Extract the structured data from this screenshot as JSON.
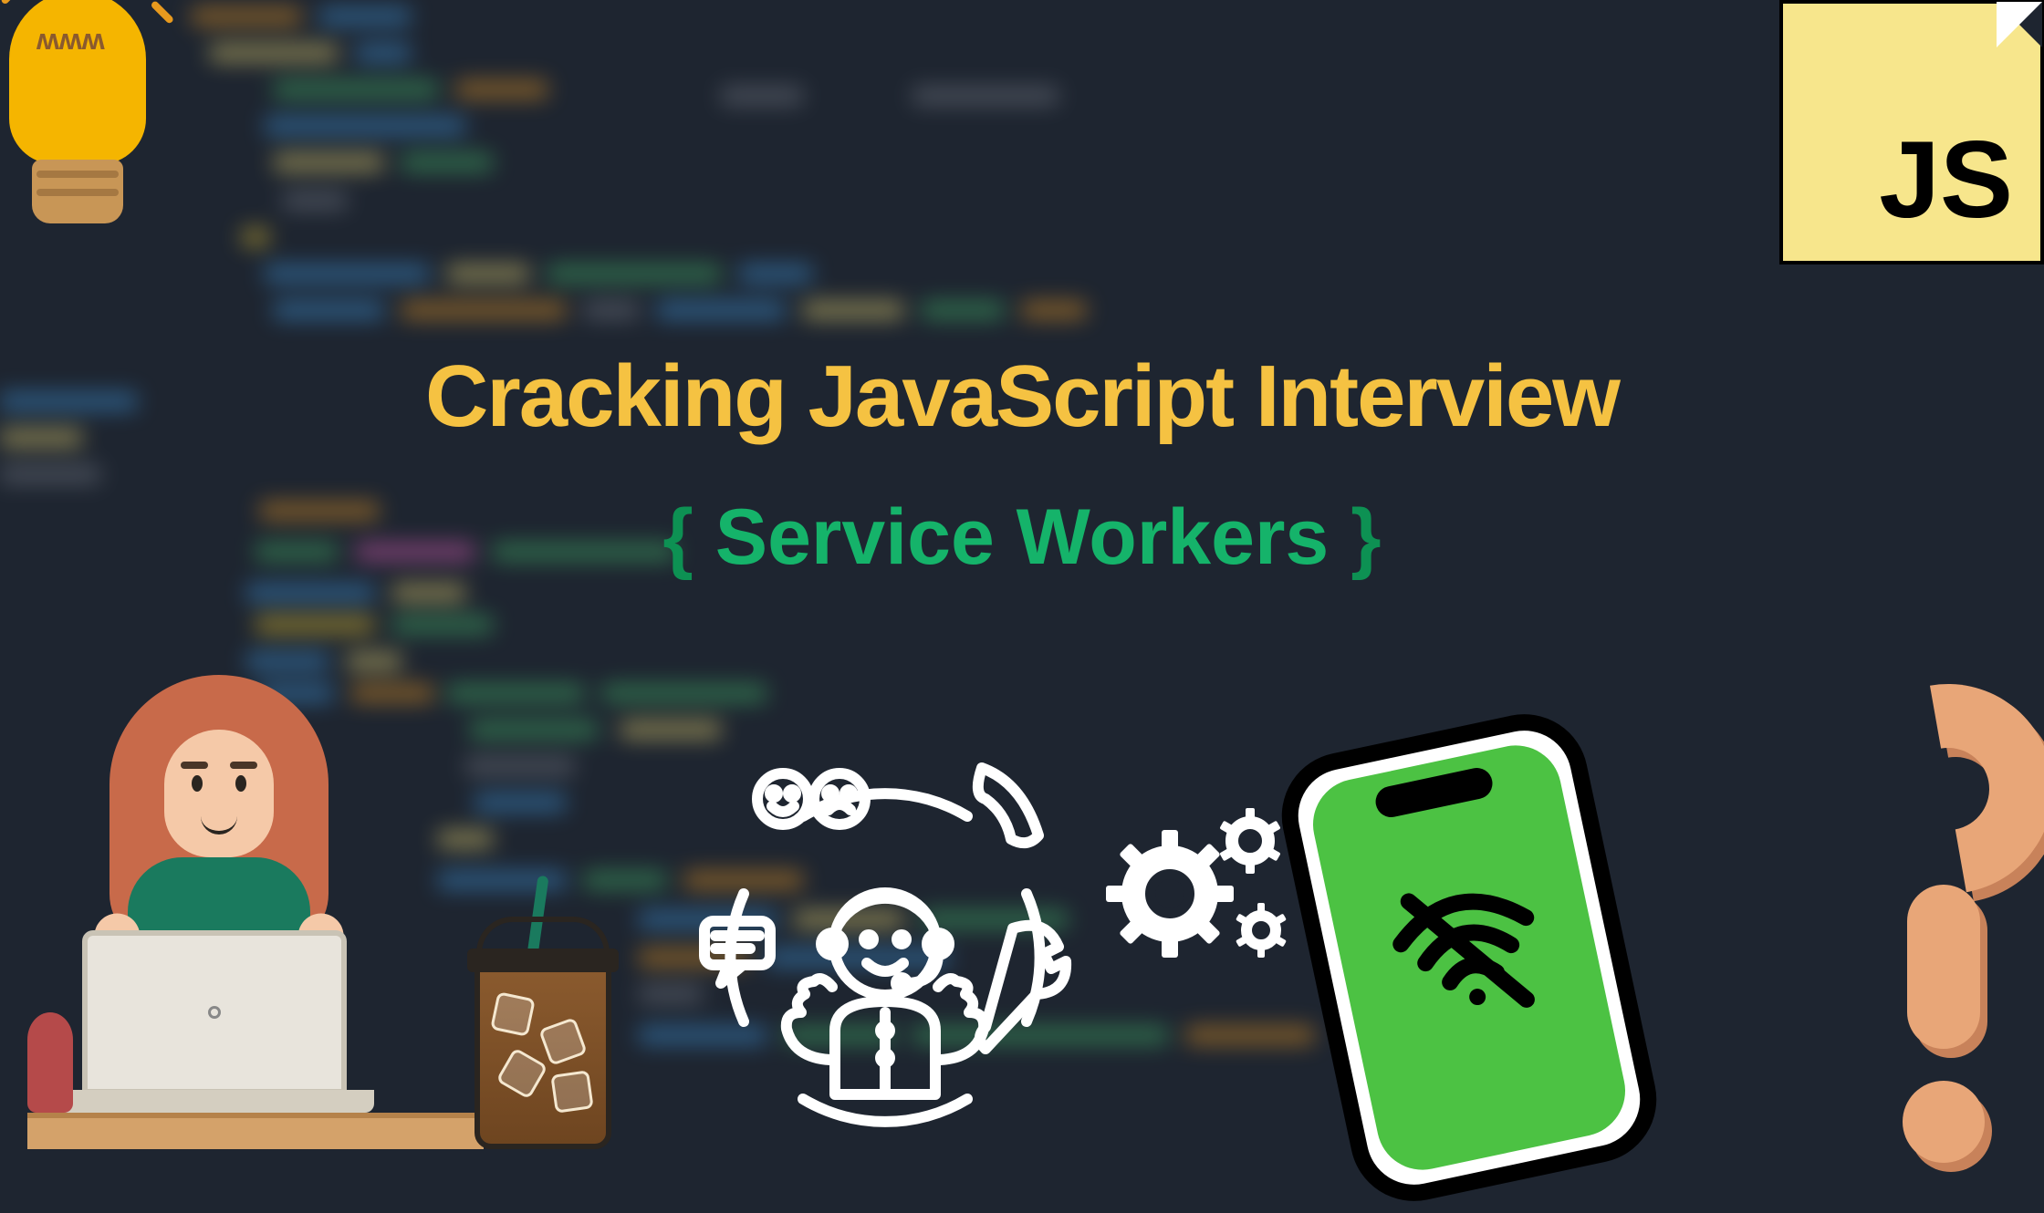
{
  "title": "Cracking JavaScript Interview",
  "subtitle_open": "{",
  "subtitle_text": " Service Workers ",
  "subtitle_close": "}",
  "badge": "JS",
  "icons": {
    "lightbulb": "lightbulb-icon",
    "woman": "woman-laptop-icon",
    "coffee": "iced-coffee-icon",
    "support": "support-agent-icon",
    "gears": "gears-icon",
    "phone": "phone-offline-icon",
    "question": "question-mark-icon",
    "wifi_off": "wifi-off-icon"
  },
  "colors": {
    "background": "#1e2530",
    "title": "#f5c242",
    "subtitle": "#15b36a",
    "badge_bg": "#f7e68c",
    "phone_screen": "#4cc243",
    "question": "#e8a678"
  }
}
